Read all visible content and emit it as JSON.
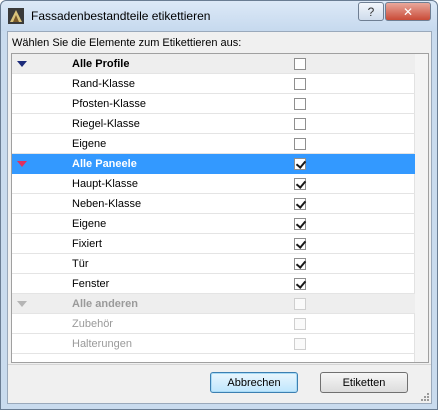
{
  "window": {
    "title": "Fassadenbestandteile etikettieren",
    "help_label": "?",
    "close_label": "✕"
  },
  "prompt": "Wählen Sie die Elemente zum Etikettieren aus:",
  "rows": [
    {
      "label": "Alle Profile",
      "type": "group",
      "checked": false,
      "selected": false,
      "disabled": false
    },
    {
      "label": "Rand-Klasse",
      "type": "child",
      "checked": false,
      "selected": false,
      "disabled": false
    },
    {
      "label": "Pfosten-Klasse",
      "type": "child",
      "checked": false,
      "selected": false,
      "disabled": false
    },
    {
      "label": "Riegel-Klasse",
      "type": "child",
      "checked": false,
      "selected": false,
      "disabled": false
    },
    {
      "label": "Eigene",
      "type": "child",
      "checked": false,
      "selected": false,
      "disabled": false
    },
    {
      "label": "Alle Paneele",
      "type": "group",
      "checked": true,
      "selected": true,
      "disabled": false
    },
    {
      "label": "Haupt-Klasse",
      "type": "child",
      "checked": true,
      "selected": false,
      "disabled": false
    },
    {
      "label": "Neben-Klasse",
      "type": "child",
      "checked": true,
      "selected": false,
      "disabled": false
    },
    {
      "label": "Eigene",
      "type": "child",
      "checked": true,
      "selected": false,
      "disabled": false
    },
    {
      "label": "Fixiert",
      "type": "child",
      "checked": true,
      "selected": false,
      "disabled": false
    },
    {
      "label": "Tür",
      "type": "child",
      "checked": true,
      "selected": false,
      "disabled": false
    },
    {
      "label": "Fenster",
      "type": "child",
      "checked": true,
      "selected": false,
      "disabled": false
    },
    {
      "label": "Alle anderen",
      "type": "group",
      "checked": false,
      "selected": false,
      "disabled": true
    },
    {
      "label": "Zubehör",
      "type": "child",
      "checked": false,
      "selected": false,
      "disabled": true
    },
    {
      "label": "Halterungen",
      "type": "child",
      "checked": false,
      "selected": false,
      "disabled": true
    }
  ],
  "buttons": {
    "cancel": "Abbrechen",
    "ok": "Etiketten"
  },
  "colors": {
    "selection": "#3399ff",
    "group_background": "#eeeeee",
    "disabled_text": "#9a9a9a",
    "triangle": "#1c2b7a"
  }
}
